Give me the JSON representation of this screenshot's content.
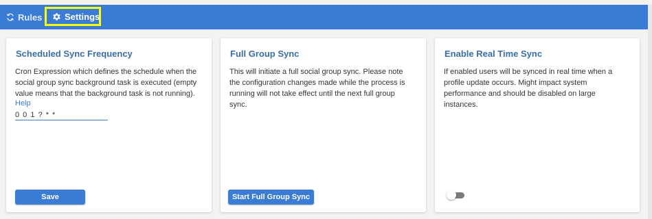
{
  "colors": {
    "accent": "#3a7bd5",
    "highlight_border": "#ffff00",
    "title_text": "#3a6ea8"
  },
  "tabs": [
    {
      "label": "Rules",
      "icon": "sync-icon"
    },
    {
      "label": "Settings",
      "icon": "gear-icon",
      "active": true
    }
  ],
  "cards": {
    "sync_frequency": {
      "title": "Scheduled Sync Frequency",
      "description": "Cron Expression which defines the schedule when the social group sync background task is executed (empty value means that the background task is not running).",
      "help_label": "Help",
      "cron_value": "0 0 1 ? * *",
      "button_label": "Save"
    },
    "full_sync": {
      "title": "Full Group Sync",
      "description": "This will initiate a full social group sync. Please note the configuration changes made while the process is running will not take effect until the next full group sync.",
      "button_label": "Start Full Group Sync"
    },
    "realtime_sync": {
      "title": "Enable Real Time Sync",
      "description": "If enabled users will be synced in real time when a profile update occurs. Might impact system performance and should be disabled on large instances.",
      "enabled": false
    }
  }
}
